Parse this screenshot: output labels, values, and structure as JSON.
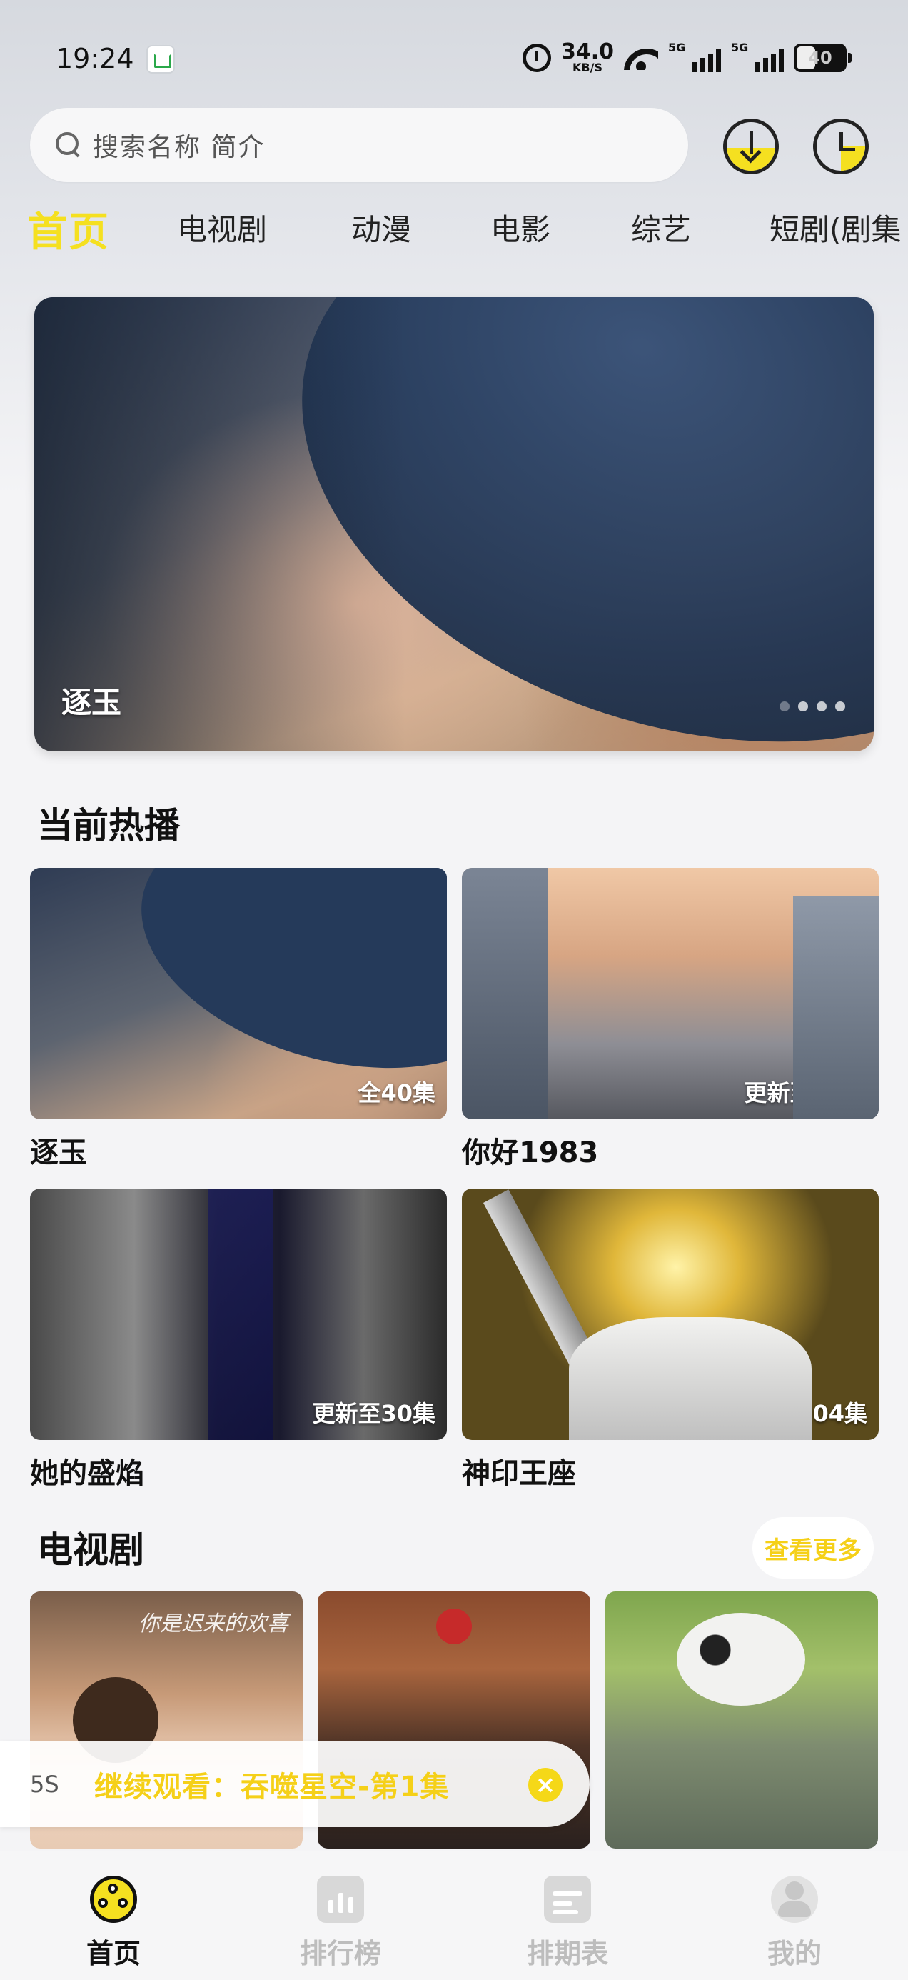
{
  "status_bar": {
    "time": "19:24",
    "net_speed": "34.0",
    "net_unit": "KB/S",
    "signal1": "5G",
    "signal2": "5G",
    "battery": "40"
  },
  "header": {
    "search_placeholder": "搜索名称 简介"
  },
  "tabs": [
    {
      "label": "首页",
      "active": true
    },
    {
      "label": "电视剧"
    },
    {
      "label": "动漫"
    },
    {
      "label": "电影"
    },
    {
      "label": "综艺"
    },
    {
      "label": "短剧(剧集"
    }
  ],
  "banner": {
    "title": "逐玉"
  },
  "hot": {
    "title": "当前热播",
    "items": [
      {
        "name": "逐玉",
        "badge": "全40集"
      },
      {
        "name": "你好1983",
        "badge": "更新至27集"
      },
      {
        "name": "她的盛焰",
        "badge": "更新至30集"
      },
      {
        "name": "神印王座",
        "badge": "更新至204集"
      }
    ]
  },
  "tv": {
    "title": "电视剧",
    "more_label": "查看更多",
    "first_card_art": "你是迟来的欢喜"
  },
  "continue_watching": {
    "prefix": "5S",
    "text": "继续观看：吞噬星空-第1集"
  },
  "bottom_nav": [
    {
      "label": "首页",
      "active": true,
      "icon": "home-reel-icon"
    },
    {
      "label": "排行榜",
      "icon": "ranking-icon"
    },
    {
      "label": "排期表",
      "icon": "schedule-icon"
    },
    {
      "label": "我的",
      "icon": "profile-icon"
    }
  ],
  "colors": {
    "accent": "#f5e020",
    "accent_text": "#f5d018",
    "background": "#f4f4f6"
  }
}
